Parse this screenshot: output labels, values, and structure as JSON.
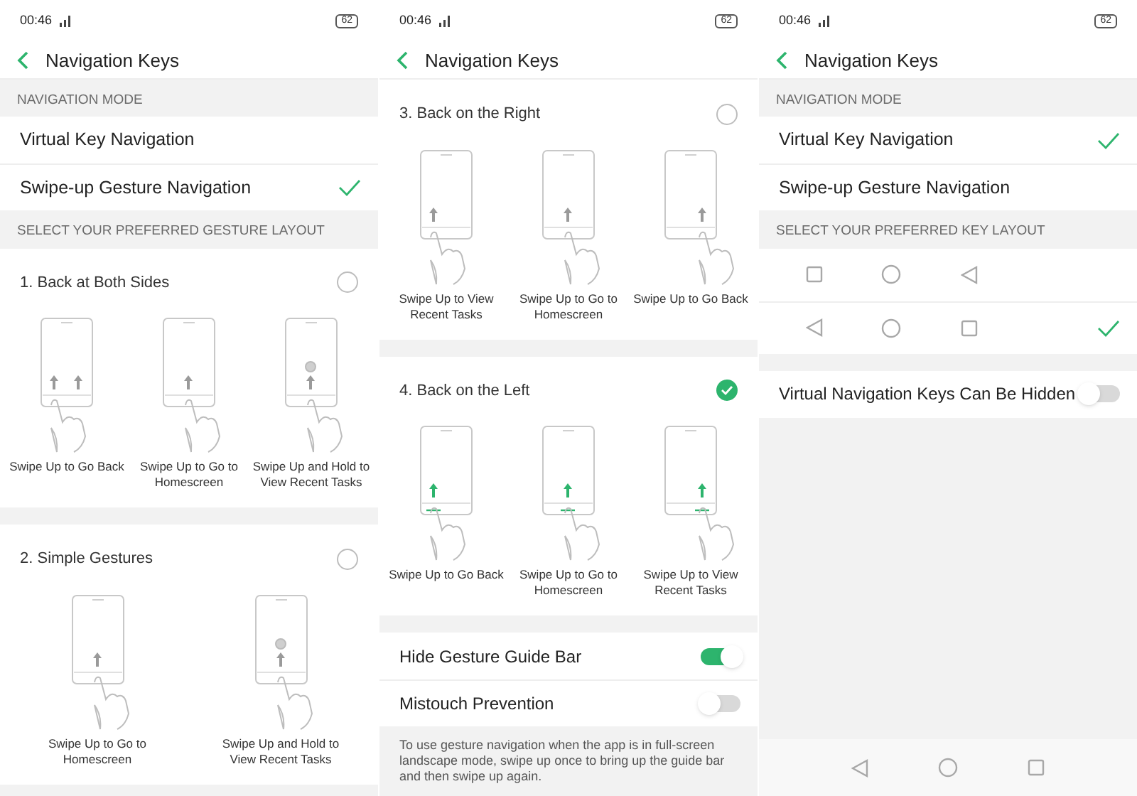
{
  "screens": [
    {
      "status": {
        "time": "00:46",
        "battery": "62"
      },
      "title": "Navigation Keys",
      "sections": [
        {
          "kind": "header",
          "text": "NAVIGATION MODE"
        },
        {
          "kind": "options",
          "items": [
            {
              "label": "Virtual Key Navigation",
              "selected": false
            },
            {
              "label": "Swipe-up Gesture Navigation",
              "selected": true
            }
          ]
        },
        {
          "kind": "header",
          "text": "SELECT YOUR PREFERRED GESTURE LAYOUT"
        },
        {
          "kind": "layout",
          "title": "1. Back at Both Sides",
          "selected": false,
          "illustrations": [
            {
              "kind": "both",
              "caption": "Swipe Up to Go Back"
            },
            {
              "kind": "center",
              "caption": "Swipe Up to Go to Homescreen"
            },
            {
              "kind": "hold",
              "caption": "Swipe Up and Hold to View Recent Tasks"
            }
          ]
        },
        {
          "kind": "band"
        },
        {
          "kind": "layout",
          "title": "2. Simple Gestures",
          "selected": false,
          "illustrations": [
            {
              "kind": "center",
              "caption": "Swipe Up to Go to Homescreen"
            },
            {
              "kind": "hold",
              "caption": "Swipe Up and Hold to View Recent Tasks"
            }
          ]
        }
      ]
    },
    {
      "status": {
        "time": "00:46",
        "battery": "62"
      },
      "title": "Navigation Keys",
      "sections": [
        {
          "kind": "layout",
          "title": "3. Back on the Right",
          "selected": false,
          "illustrations": [
            {
              "kind": "left",
              "caption": "Swipe Up to View Recent Tasks"
            },
            {
              "kind": "center",
              "caption": "Swipe Up to Go to Homescreen"
            },
            {
              "kind": "right",
              "caption": "Swipe Up to Go Back"
            }
          ]
        },
        {
          "kind": "band"
        },
        {
          "kind": "layout",
          "title": "4. Back on the Left",
          "selected": true,
          "illustrations": [
            {
              "kind": "left",
              "caption": "Swipe Up to Go Back"
            },
            {
              "kind": "center",
              "caption": "Swipe Up to Go to Homescreen"
            },
            {
              "kind": "right",
              "caption": "Swipe Up to View Recent Tasks"
            }
          ]
        },
        {
          "kind": "band"
        },
        {
          "kind": "switches",
          "items": [
            {
              "label": "Hide Gesture Guide Bar",
              "on": true
            },
            {
              "label": "Mistouch Prevention",
              "on": false
            }
          ]
        },
        {
          "kind": "note",
          "text": "To use gesture navigation when the app is in full-screen landscape mode, swipe up once to bring up the guide bar and then swipe up again."
        }
      ]
    },
    {
      "status": {
        "time": "00:46",
        "battery": "62"
      },
      "title": "Navigation Keys",
      "sections": [
        {
          "kind": "header",
          "text": "NAVIGATION MODE"
        },
        {
          "kind": "options",
          "items": [
            {
              "label": "Virtual Key Navigation",
              "selected": true
            },
            {
              "label": "Swipe-up Gesture Navigation",
              "selected": false
            }
          ]
        },
        {
          "kind": "header",
          "text": "SELECT YOUR PREFERRED KEY LAYOUT"
        },
        {
          "kind": "key_rows",
          "items": [
            {
              "keys": [
                {
                  "kind": "square"
                },
                {
                  "kind": "circle"
                },
                {
                  "kind": "triangle"
                }
              ],
              "selected": false
            },
            {
              "keys": [
                {
                  "kind": "triangle"
                },
                {
                  "kind": "circle"
                },
                {
                  "kind": "square"
                }
              ],
              "selected": true
            }
          ]
        },
        {
          "kind": "band"
        },
        {
          "kind": "switches",
          "items": [
            {
              "label": "Virtual Navigation Keys Can Be Hidden",
              "on": false
            }
          ]
        },
        {
          "kind": "nav_bar"
        }
      ]
    }
  ]
}
